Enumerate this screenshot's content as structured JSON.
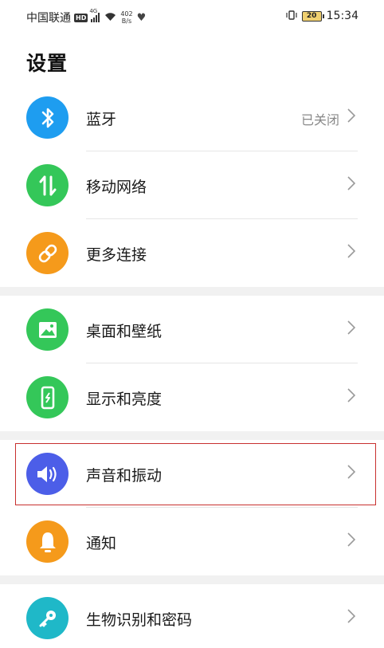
{
  "status_bar": {
    "carrier": "中国联通",
    "hd": "HD",
    "network_type": "4G",
    "speed_value": "402",
    "speed_unit": "B/s",
    "battery": "20",
    "time": "15:34"
  },
  "page": {
    "title": "设置"
  },
  "settings": [
    {
      "label": "蓝牙",
      "value": "已关闭",
      "icon": "bluetooth-icon",
      "color": "#1e9df0"
    },
    {
      "label": "移动网络",
      "value": "",
      "icon": "mobile-data-icon",
      "color": "#34c759"
    },
    {
      "label": "更多连接",
      "value": "",
      "icon": "link-icon",
      "color": "#f59a1b"
    },
    {
      "label": "桌面和壁纸",
      "value": "",
      "icon": "wallpaper-icon",
      "color": "#34c759"
    },
    {
      "label": "显示和亮度",
      "value": "",
      "icon": "display-icon",
      "color": "#34c759"
    },
    {
      "label": "声音和振动",
      "value": "",
      "icon": "sound-icon",
      "color": "#4c5ee8"
    },
    {
      "label": "通知",
      "value": "",
      "icon": "bell-icon",
      "color": "#f59a1b"
    },
    {
      "label": "生物识别和密码",
      "value": "",
      "icon": "key-icon",
      "color": "#1fb8c8"
    }
  ]
}
